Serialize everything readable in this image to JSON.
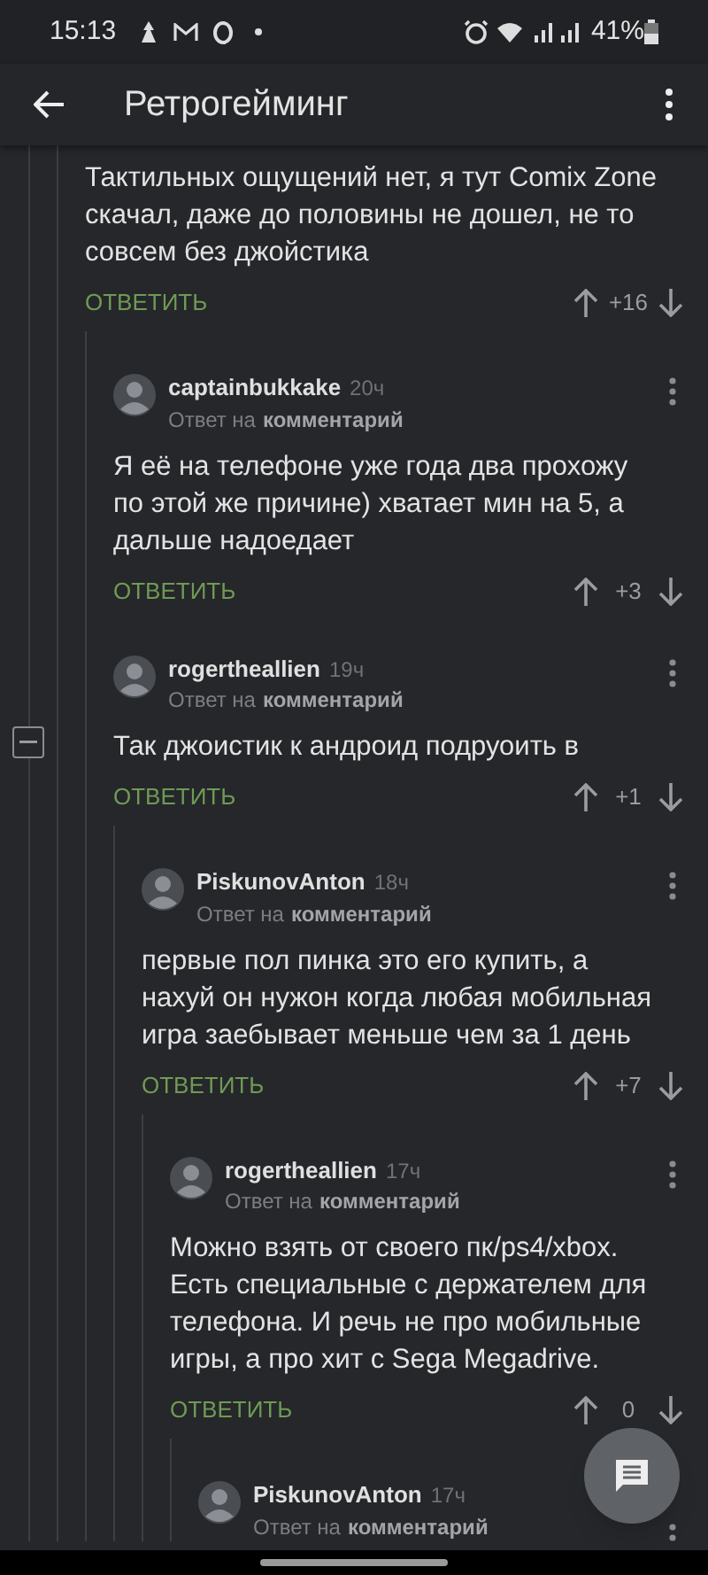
{
  "status_bar": {
    "time": "15:13",
    "battery": "41%"
  },
  "app_bar": {
    "title": "Ретрогейминг"
  },
  "thread": {
    "text": "Тактильных ощущений нет, я тут Comix Zone скачал, даже до половины не дошел, не то совсем без джойстика",
    "reply": "ОТВЕТИТЬ",
    "votes": "+16",
    "children": [
      {
        "author": "captainbukkake",
        "time": "20ч",
        "reply_prefix": "Ответ на",
        "reply_target": "комментарий",
        "text": "Я её на телефоне уже года два прохожу по этой же причине) хватает мин на 5, а дальше надоедает",
        "reply": "ОТВЕТИТЬ",
        "votes": "+3"
      },
      {
        "author": "rogertheallien",
        "time": "19ч",
        "reply_prefix": "Ответ на",
        "reply_target": "комментарий",
        "text": "Так джоистик к андроид подруоить в",
        "reply": "ОТВЕТИТЬ",
        "votes": "+1",
        "collapse": true,
        "children": [
          {
            "author": "PiskunovAnton",
            "time": "18ч",
            "reply_prefix": "Ответ на",
            "reply_target": "комментарий",
            "text": "первые пол пинка это его купить, а нахуй он нужон когда любая мобильная игра заебывает меньше чем за 1 день",
            "reply": "ОТВЕТИТЬ",
            "votes": "+7",
            "children": [
              {
                "author": "rogertheallien",
                "time": "17ч",
                "reply_prefix": "Ответ на",
                "reply_target": "комментарий",
                "text": "Можно взять от своего пк/ps4/xbox. Есть специальные с держателем для телефона. И речь не про мобильные игры, а про хит с Sega Megadrive.",
                "reply": "ОТВЕТИТЬ",
                "votes": "0",
                "children": [
                  {
                    "author": "PiskunovAnton",
                    "time": "17ч",
                    "reply_prefix": "Ответ на",
                    "reply_target": "комментарий"
                  }
                ]
              }
            ]
          }
        ]
      }
    ]
  }
}
